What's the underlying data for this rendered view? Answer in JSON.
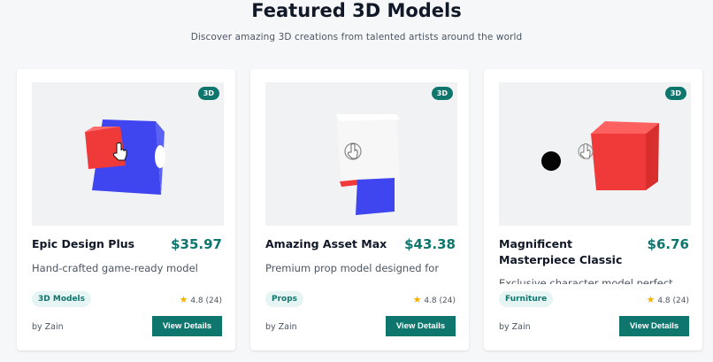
{
  "header": {
    "title": "Featured 3D Models",
    "subtitle": "Discover amazing 3D creations from talented artists around the world"
  },
  "cards": [
    {
      "badge": "3D",
      "name": "Epic Design Plus",
      "price": "$35.97",
      "description": "Hand-crafted game-ready model suitable for commercial use",
      "tag": "3D Models",
      "rating": "4.8",
      "reviews": "(24)",
      "author": "by Zain",
      "button": "View Details"
    },
    {
      "badge": "3D",
      "name": "Amazing Asset Max",
      "price": "$43.38",
      "description": "Premium prop model designed for professional workflows",
      "tag": "Props",
      "rating": "4.8",
      "reviews": "(24)",
      "author": "by Zain",
      "button": "View Details"
    },
    {
      "badge": "3D",
      "name": "Magnificent Masterpiece Classic",
      "price": "$6.76",
      "description": "Exclusive character model perfect for",
      "tag": "Furniture",
      "rating": "4.8",
      "reviews": "(24)",
      "author": "by Zain",
      "button": "View Details"
    }
  ],
  "icons": {
    "star": "star-icon",
    "cursor": "hand-pointer-icon"
  },
  "colors": {
    "accent": "#0f766e",
    "star": "#f5b301",
    "cube_red": "#f03a3a",
    "cube_blue": "#3f46f0"
  }
}
